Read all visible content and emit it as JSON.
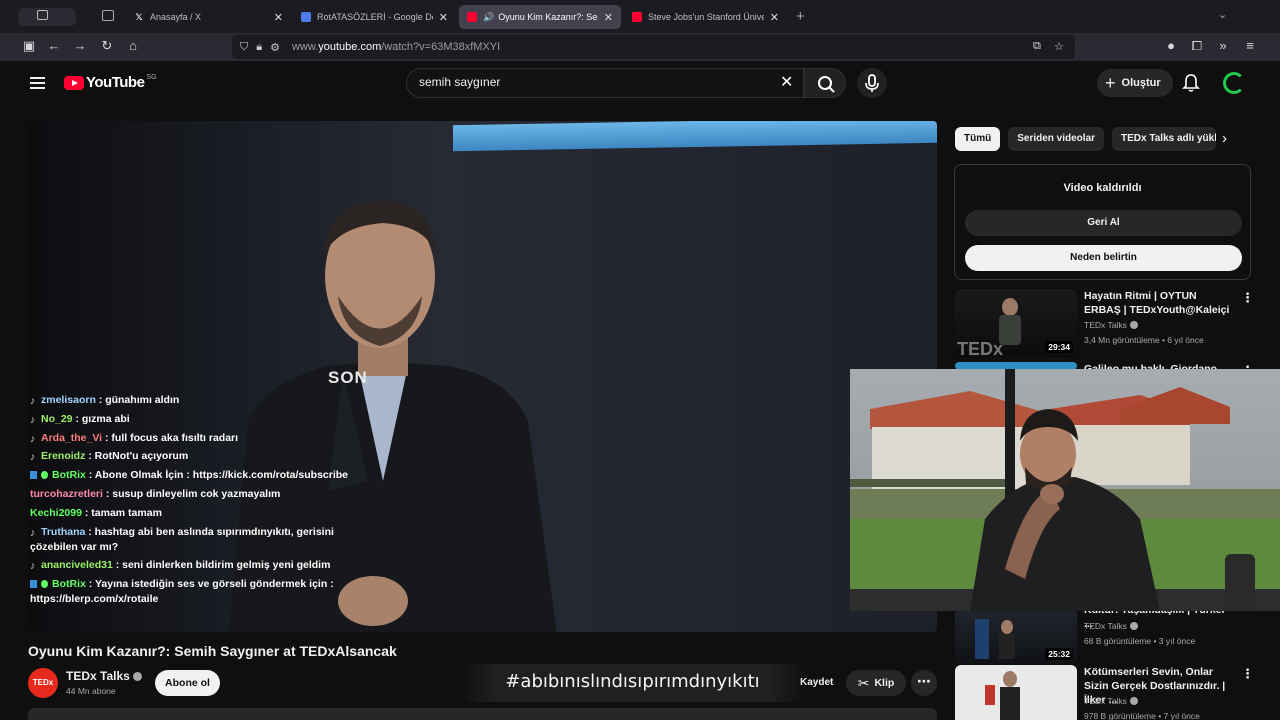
{
  "browser": {
    "tabs": [
      {
        "title": "Anasayfa / X",
        "favicon": "x-logo-icon",
        "active": false
      },
      {
        "title": "RotATASÖZLERİ - Google Dokümanlar",
        "favicon": "docs-icon",
        "active": false
      },
      {
        "title": "Oyunu Kim Kazanır?: Semih",
        "favicon": "youtube-icon",
        "active": true
      },
      {
        "title": "Steve Jobs'un Stanford Üniversitesi",
        "favicon": "youtube-icon",
        "active": false
      }
    ],
    "url_prefix": "www.",
    "url_domain": "youtube.com",
    "url_path": "/watch?v=63M38xfMXYI"
  },
  "youtube": {
    "logo_text": "YouTube",
    "country_code": "SG",
    "search_value": "semih saygıner",
    "create_label": "Oluştur"
  },
  "chat": [
    {
      "user": "zmelisaorn",
      "text": ": günahımı aldın",
      "color": "#9fd4ff"
    },
    {
      "user": "No_29",
      "text": ": gızma abi",
      "color": "#9cf06a"
    },
    {
      "user": "Arda_the_Vi",
      "text": ": full focus aka fısıltı radarı",
      "color": "#ff7a7a"
    },
    {
      "user": "Erenoidz",
      "text": ": RotNot'u açıyorum",
      "color": "#9cf06a"
    },
    {
      "user": "BotRix",
      "text": ": Abone Olmak İçin : https://kick.com/rota/subscribe",
      "color": "#62ff62"
    },
    {
      "user": "turcohazretleri",
      "text": ": susup dinleyelim cok yazmayalım",
      "color": "#ff88a8"
    },
    {
      "user": "Kechi2099",
      "text": ": tamam tamam",
      "color": "#62ff62"
    },
    {
      "user": "Truthana",
      "text": ": hashtag abi ben aslında sıpırımdınyıkıtı, gerisini çözebilen var mı?",
      "color": "#9fd4ff"
    },
    {
      "user": "ananciveled31",
      "text": ": seni dinlerken bildirim gelmiş yeni geldim",
      "color": "#9cf06a"
    },
    {
      "user": "BotRix",
      "text": ": Yayına istediğin ses ve görseli göndermek için : https://blerp.com/x/rotaile",
      "color": "#62ff62"
    }
  ],
  "video": {
    "sign_text": "SON",
    "title": "Oyunu Kim Kazanır?: Semih Saygıner at TEDxAlsancak",
    "channel": "TEDx Talks",
    "channel_avatar_text": "TEDx",
    "subscribers": "44 Mn abone",
    "subscribe_label": "Abone ol",
    "overlay_hashtag": "#abıbınıslındısıpırımdınyıkıtı",
    "save_label": "Kaydet",
    "clip_label": "Klip"
  },
  "sidebar": {
    "chips": [
      "Tümü",
      "Seriden videolar",
      "TEDx Talks adlı yükleyiciden"
    ],
    "removed": {
      "heading": "Video kaldırıldı",
      "undo_label": "Geri Al",
      "why_label": "Neden belirtin"
    },
    "recs": [
      {
        "title": "Hayatın Ritmi | OYTUN ERBAŞ | TEDxYouth@Kaleiçi",
        "channel": "TEDx Talks",
        "meta": "3,4 Mn görüntüleme • 6 yıl önce",
        "duration": "29:34"
      },
      {
        "title": "Galileo mu haklı, Giordano",
        "channel": "",
        "meta": "",
        "duration": ""
      },
      {
        "title": "Kültür: Yaşamdaşlık | Türker ...",
        "channel": "TEDx Talks",
        "meta": "68 B görüntüleme • 3 yıl önce",
        "duration": "25:32"
      },
      {
        "title": "Kötümserleri Sevin, Onlar Sizin Gerçek Dostlarınızdır. | İlker ...",
        "channel": "TEDx Talks",
        "meta": "978 B görüntüleme • 7 yıl önce",
        "duration": ""
      }
    ]
  }
}
